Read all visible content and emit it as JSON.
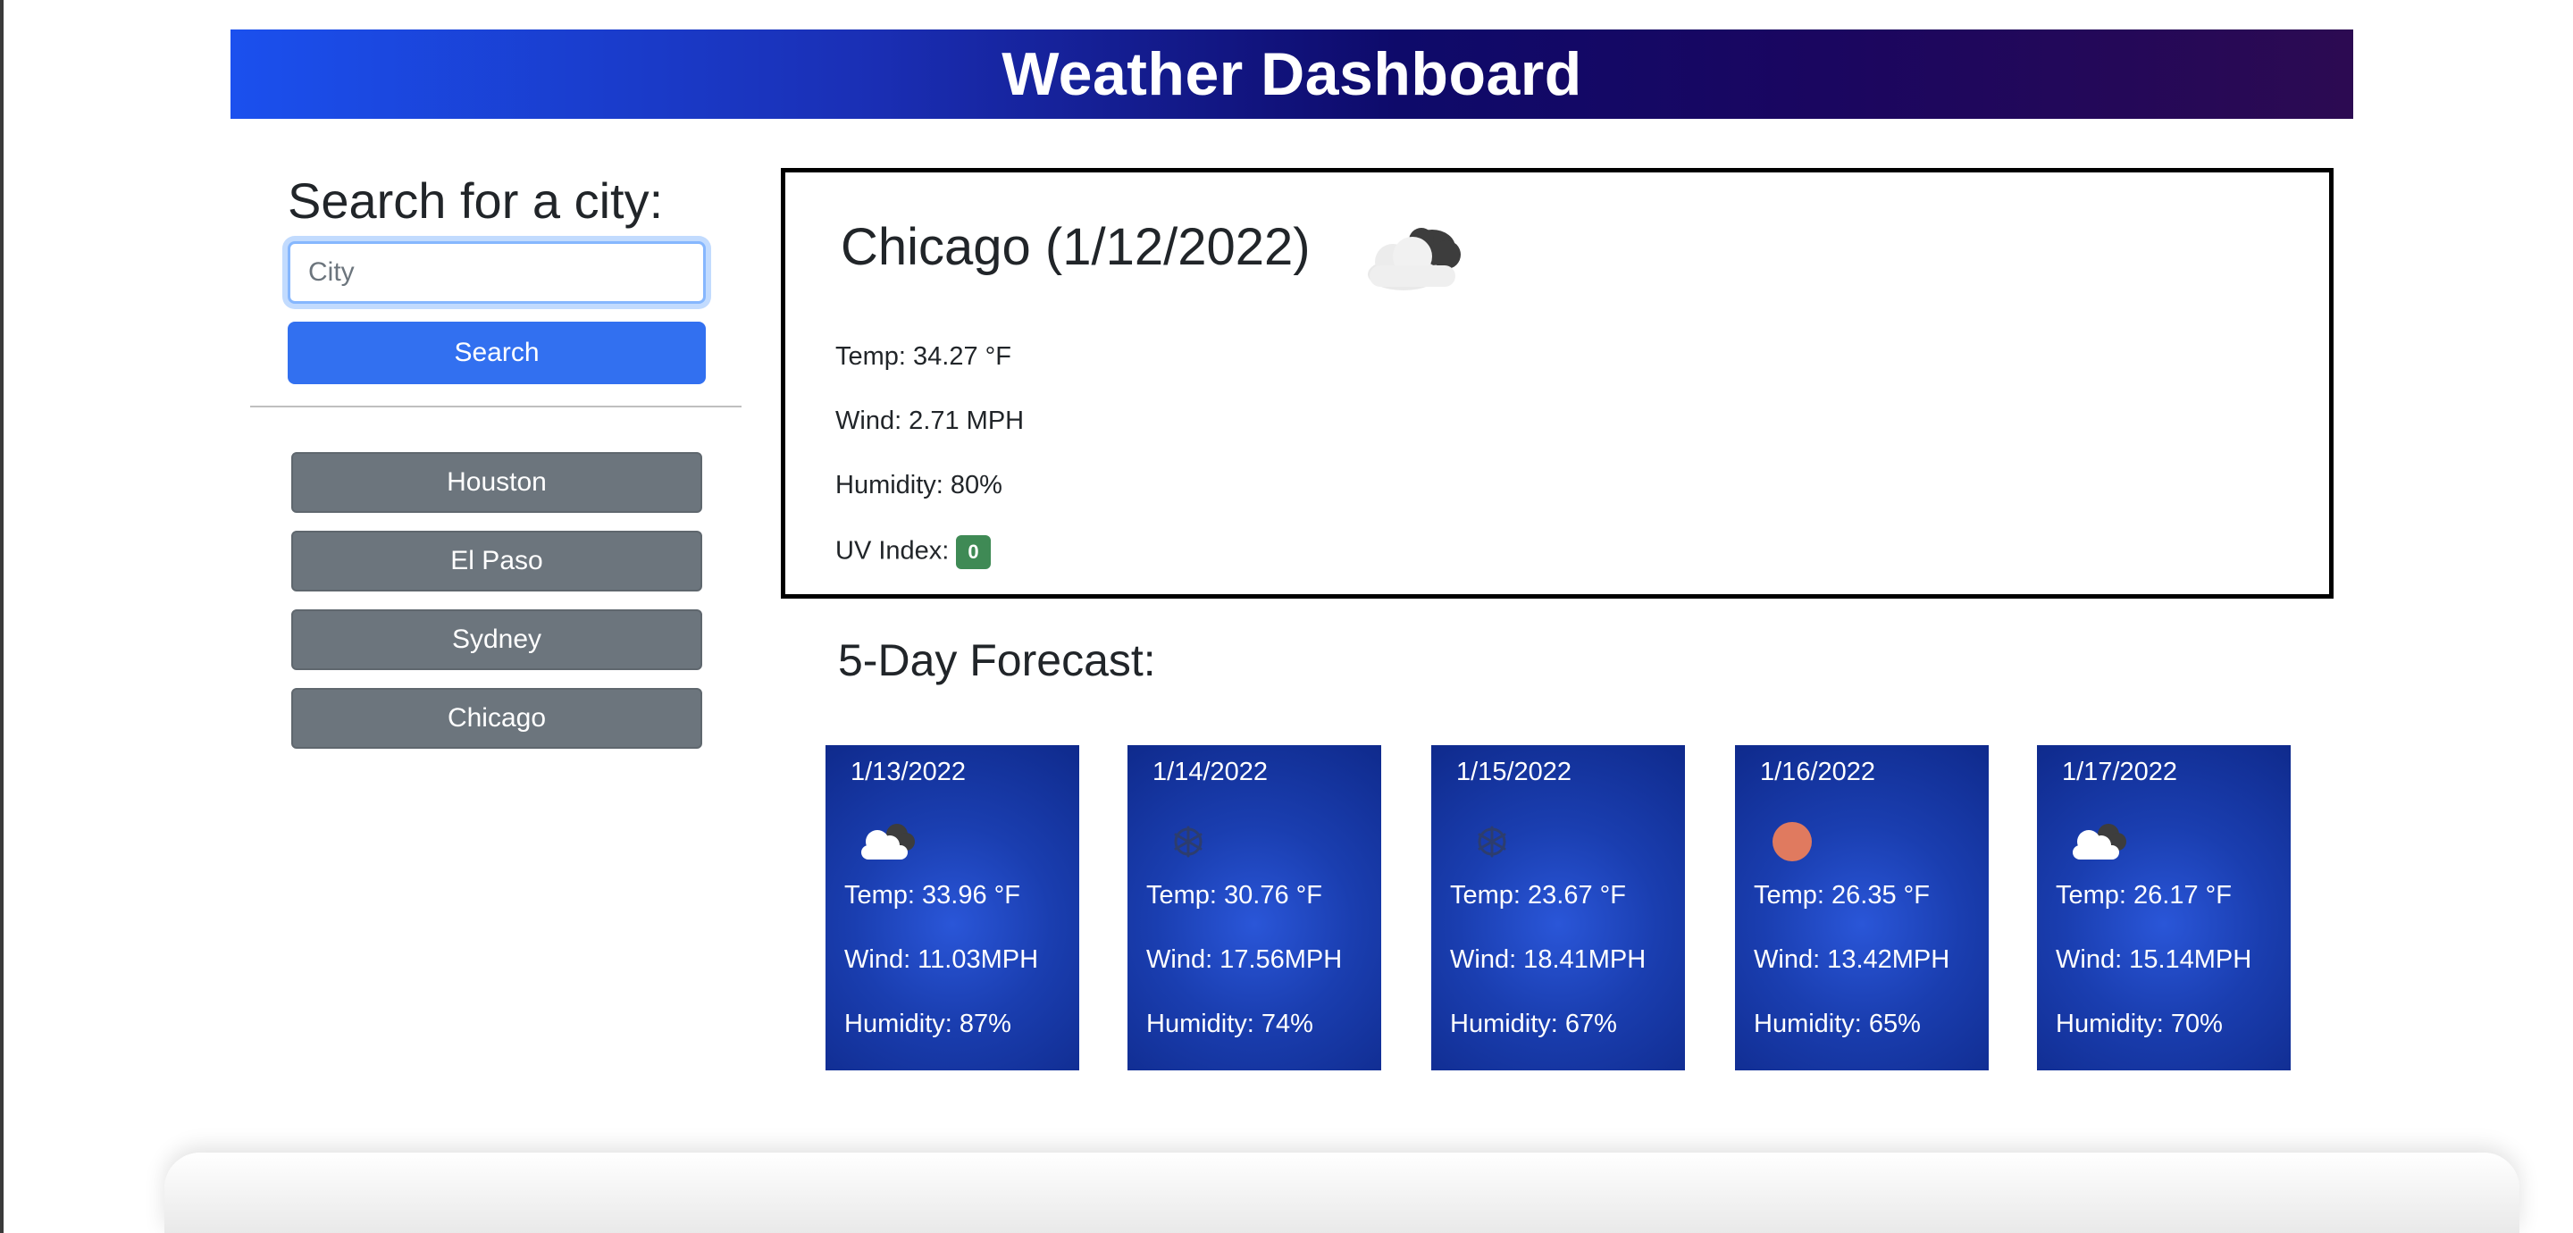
{
  "header": {
    "title": "Weather Dashboard"
  },
  "search": {
    "heading": "Search for a city:",
    "placeholder": "City",
    "button_label": "Search"
  },
  "history": {
    "items": [
      {
        "label": "Houston"
      },
      {
        "label": "El Paso"
      },
      {
        "label": "Sydney"
      },
      {
        "label": "Chicago"
      }
    ]
  },
  "current": {
    "title": "Chicago (1/12/2022)",
    "icon": "cloud-partly-icon",
    "temp": "Temp: 34.27 °F",
    "wind": "Wind: 2.71 MPH",
    "humidity": "Humidity: 80%",
    "uv_label": "UV Index:",
    "uv_value": "0",
    "uv_color": "#3f8a55"
  },
  "forecast": {
    "heading": "5-Day Forecast:",
    "days": [
      {
        "date": "1/13/2022",
        "icon": "broken-clouds-icon",
        "temp": "Temp: 33.96 °F",
        "wind": "Wind: 11.03MPH",
        "humidity": "Humidity: 87%"
      },
      {
        "date": "1/14/2022",
        "icon": "snow-icon",
        "temp": "Temp: 30.76 °F",
        "wind": "Wind: 17.56MPH",
        "humidity": "Humidity: 74%"
      },
      {
        "date": "1/15/2022",
        "icon": "snow-icon",
        "temp": "Temp: 23.67 °F",
        "wind": "Wind: 18.41MPH",
        "humidity": "Humidity: 67%"
      },
      {
        "date": "1/16/2022",
        "icon": "sun-icon",
        "temp": "Temp: 26.35 °F",
        "wind": "Wind: 13.42MPH",
        "humidity": "Humidity: 65%"
      },
      {
        "date": "1/17/2022",
        "icon": "broken-clouds-icon",
        "temp": "Temp: 26.17 °F",
        "wind": "Wind: 15.14MPH",
        "humidity": "Humidity: 70%"
      }
    ]
  },
  "colors": {
    "search_button": "#3270f0",
    "history_button": "#6c757d",
    "card_background": "#1a3eb0",
    "sun": "#e07a5f"
  }
}
